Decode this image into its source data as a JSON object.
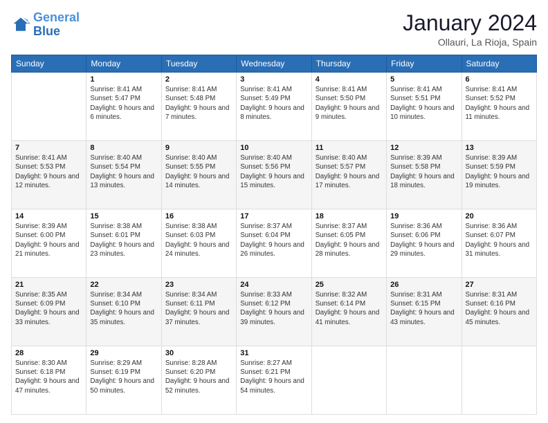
{
  "header": {
    "logo_line1": "General",
    "logo_line2": "Blue",
    "title": "January 2024",
    "location": "Ollauri, La Rioja, Spain"
  },
  "weekdays": [
    "Sunday",
    "Monday",
    "Tuesday",
    "Wednesday",
    "Thursday",
    "Friday",
    "Saturday"
  ],
  "weeks": [
    [
      {
        "day": "",
        "sunrise": "",
        "sunset": "",
        "daylight": ""
      },
      {
        "day": "1",
        "sunrise": "Sunrise: 8:41 AM",
        "sunset": "Sunset: 5:47 PM",
        "daylight": "Daylight: 9 hours and 6 minutes."
      },
      {
        "day": "2",
        "sunrise": "Sunrise: 8:41 AM",
        "sunset": "Sunset: 5:48 PM",
        "daylight": "Daylight: 9 hours and 7 minutes."
      },
      {
        "day": "3",
        "sunrise": "Sunrise: 8:41 AM",
        "sunset": "Sunset: 5:49 PM",
        "daylight": "Daylight: 9 hours and 8 minutes."
      },
      {
        "day": "4",
        "sunrise": "Sunrise: 8:41 AM",
        "sunset": "Sunset: 5:50 PM",
        "daylight": "Daylight: 9 hours and 9 minutes."
      },
      {
        "day": "5",
        "sunrise": "Sunrise: 8:41 AM",
        "sunset": "Sunset: 5:51 PM",
        "daylight": "Daylight: 9 hours and 10 minutes."
      },
      {
        "day": "6",
        "sunrise": "Sunrise: 8:41 AM",
        "sunset": "Sunset: 5:52 PM",
        "daylight": "Daylight: 9 hours and 11 minutes."
      }
    ],
    [
      {
        "day": "7",
        "sunrise": "Sunrise: 8:41 AM",
        "sunset": "Sunset: 5:53 PM",
        "daylight": "Daylight: 9 hours and 12 minutes."
      },
      {
        "day": "8",
        "sunrise": "Sunrise: 8:40 AM",
        "sunset": "Sunset: 5:54 PM",
        "daylight": "Daylight: 9 hours and 13 minutes."
      },
      {
        "day": "9",
        "sunrise": "Sunrise: 8:40 AM",
        "sunset": "Sunset: 5:55 PM",
        "daylight": "Daylight: 9 hours and 14 minutes."
      },
      {
        "day": "10",
        "sunrise": "Sunrise: 8:40 AM",
        "sunset": "Sunset: 5:56 PM",
        "daylight": "Daylight: 9 hours and 15 minutes."
      },
      {
        "day": "11",
        "sunrise": "Sunrise: 8:40 AM",
        "sunset": "Sunset: 5:57 PM",
        "daylight": "Daylight: 9 hours and 17 minutes."
      },
      {
        "day": "12",
        "sunrise": "Sunrise: 8:39 AM",
        "sunset": "Sunset: 5:58 PM",
        "daylight": "Daylight: 9 hours and 18 minutes."
      },
      {
        "day": "13",
        "sunrise": "Sunrise: 8:39 AM",
        "sunset": "Sunset: 5:59 PM",
        "daylight": "Daylight: 9 hours and 19 minutes."
      }
    ],
    [
      {
        "day": "14",
        "sunrise": "Sunrise: 8:39 AM",
        "sunset": "Sunset: 6:00 PM",
        "daylight": "Daylight: 9 hours and 21 minutes."
      },
      {
        "day": "15",
        "sunrise": "Sunrise: 8:38 AM",
        "sunset": "Sunset: 6:01 PM",
        "daylight": "Daylight: 9 hours and 23 minutes."
      },
      {
        "day": "16",
        "sunrise": "Sunrise: 8:38 AM",
        "sunset": "Sunset: 6:03 PM",
        "daylight": "Daylight: 9 hours and 24 minutes."
      },
      {
        "day": "17",
        "sunrise": "Sunrise: 8:37 AM",
        "sunset": "Sunset: 6:04 PM",
        "daylight": "Daylight: 9 hours and 26 minutes."
      },
      {
        "day": "18",
        "sunrise": "Sunrise: 8:37 AM",
        "sunset": "Sunset: 6:05 PM",
        "daylight": "Daylight: 9 hours and 28 minutes."
      },
      {
        "day": "19",
        "sunrise": "Sunrise: 8:36 AM",
        "sunset": "Sunset: 6:06 PM",
        "daylight": "Daylight: 9 hours and 29 minutes."
      },
      {
        "day": "20",
        "sunrise": "Sunrise: 8:36 AM",
        "sunset": "Sunset: 6:07 PM",
        "daylight": "Daylight: 9 hours and 31 minutes."
      }
    ],
    [
      {
        "day": "21",
        "sunrise": "Sunrise: 8:35 AM",
        "sunset": "Sunset: 6:09 PM",
        "daylight": "Daylight: 9 hours and 33 minutes."
      },
      {
        "day": "22",
        "sunrise": "Sunrise: 8:34 AM",
        "sunset": "Sunset: 6:10 PM",
        "daylight": "Daylight: 9 hours and 35 minutes."
      },
      {
        "day": "23",
        "sunrise": "Sunrise: 8:34 AM",
        "sunset": "Sunset: 6:11 PM",
        "daylight": "Daylight: 9 hours and 37 minutes."
      },
      {
        "day": "24",
        "sunrise": "Sunrise: 8:33 AM",
        "sunset": "Sunset: 6:12 PM",
        "daylight": "Daylight: 9 hours and 39 minutes."
      },
      {
        "day": "25",
        "sunrise": "Sunrise: 8:32 AM",
        "sunset": "Sunset: 6:14 PM",
        "daylight": "Daylight: 9 hours and 41 minutes."
      },
      {
        "day": "26",
        "sunrise": "Sunrise: 8:31 AM",
        "sunset": "Sunset: 6:15 PM",
        "daylight": "Daylight: 9 hours and 43 minutes."
      },
      {
        "day": "27",
        "sunrise": "Sunrise: 8:31 AM",
        "sunset": "Sunset: 6:16 PM",
        "daylight": "Daylight: 9 hours and 45 minutes."
      }
    ],
    [
      {
        "day": "28",
        "sunrise": "Sunrise: 8:30 AM",
        "sunset": "Sunset: 6:18 PM",
        "daylight": "Daylight: 9 hours and 47 minutes."
      },
      {
        "day": "29",
        "sunrise": "Sunrise: 8:29 AM",
        "sunset": "Sunset: 6:19 PM",
        "daylight": "Daylight: 9 hours and 50 minutes."
      },
      {
        "day": "30",
        "sunrise": "Sunrise: 8:28 AM",
        "sunset": "Sunset: 6:20 PM",
        "daylight": "Daylight: 9 hours and 52 minutes."
      },
      {
        "day": "31",
        "sunrise": "Sunrise: 8:27 AM",
        "sunset": "Sunset: 6:21 PM",
        "daylight": "Daylight: 9 hours and 54 minutes."
      },
      {
        "day": "",
        "sunrise": "",
        "sunset": "",
        "daylight": ""
      },
      {
        "day": "",
        "sunrise": "",
        "sunset": "",
        "daylight": ""
      },
      {
        "day": "",
        "sunrise": "",
        "sunset": "",
        "daylight": ""
      }
    ]
  ]
}
